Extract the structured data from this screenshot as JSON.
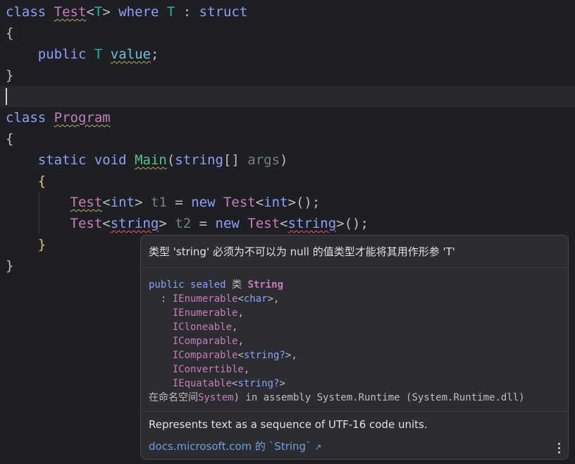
{
  "code": {
    "l1": {
      "k1": "class",
      "t1": "Test",
      "p1": "<",
      "t2": "T",
      "p2": ">",
      "k2": " where ",
      "t3": "T",
      "p3": " : ",
      "k3": "struct"
    },
    "l2": "{",
    "l3": {
      "k1": "public",
      "t1": "T",
      "f1": "value",
      "p1": ";"
    },
    "l4": "}",
    "l6": {
      "k1": "class",
      "t1": "Program"
    },
    "l7": "{",
    "l8": {
      "k1": "static",
      "k2": "void",
      "m1": "Main",
      "p1": "(",
      "k3": "string",
      "p2": "[] ",
      "a1": "args",
      "p3": ")"
    },
    "l9": "{",
    "l10": {
      "t1": "Test",
      "p1": "<",
      "k1": "int",
      "p2": ">",
      "v1": "t1",
      "p3": " = ",
      "k2": "new",
      "t2": "Test",
      "p4": "<",
      "k3": "int",
      "p5": ">();"
    },
    "l11": {
      "t1": "Test",
      "p1": "<",
      "k1": "string",
      "p2": ">",
      "v1": "t2",
      "p3": " = ",
      "k2": "new",
      "t2": "Test",
      "p4": "<",
      "k3": "string",
      "p5": ">();"
    },
    "l12": "}",
    "l13": "}"
  },
  "popup": {
    "error": "类型 'string' 必须为不可以为 null 的值类型才能将其用作形参 'T'",
    "signature": {
      "public": "public",
      "sealed": "sealed",
      "kind": "类",
      "name": "String",
      "bases": [
        {
          "name": "IEnumerable",
          "generic": "char",
          "suffix": ","
        },
        {
          "name": "IEnumerable",
          "generic": "",
          "suffix": ","
        },
        {
          "name": "ICloneable",
          "generic": "",
          "suffix": ","
        },
        {
          "name": "IComparable",
          "generic": "",
          "suffix": ","
        },
        {
          "name": "IComparable",
          "generic": "string?",
          "suffix": ","
        },
        {
          "name": "IConvertible",
          "generic": "",
          "suffix": ","
        },
        {
          "name": "IEquatable",
          "generic": "string?",
          "suffix": ""
        }
      ],
      "ns_prefix": "在命名空间",
      "namespace": "System",
      "assembly": ") in assembly System.Runtime (System.Runtime.dll)"
    },
    "description": "Represents text as a sequence of UTF-16 code units.",
    "link": "docs.microsoft.com 的 `String`",
    "link_icon": "external-link-arrow-icon"
  },
  "colors": {
    "background": "#1e1f22",
    "keyword": "#8f9ffa",
    "type": "#c77dbb",
    "popup_bg": "#2b2d30"
  }
}
